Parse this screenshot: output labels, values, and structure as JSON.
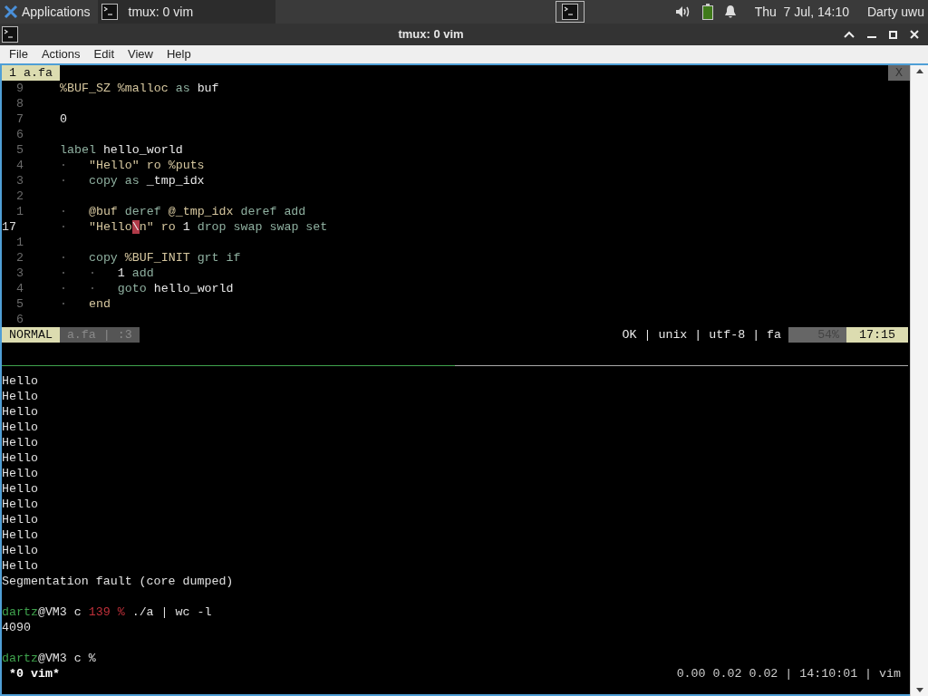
{
  "panel": {
    "menu_label": "Applications",
    "tasks": [
      {
        "label": "tmux: 0 vim",
        "selected": true
      }
    ],
    "clock": "Thu  7 Jul, 14:10",
    "user": "Darty uwu"
  },
  "window": {
    "title": "tmux: 0 vim"
  },
  "menu": [
    "File",
    "Actions",
    "Edit",
    "View",
    "Help"
  ],
  "vim": {
    "tabs": [
      {
        "label": "1 a.fa",
        "selected": true
      }
    ],
    "close_label": "X",
    "lines": [
      {
        "number": "9",
        "current": false,
        "segments": [
          {
            "kind": "literal",
            "text": "%BUF_SZ %malloc "
          },
          {
            "kind": "keyword",
            "text": "as "
          },
          {
            "kind": "plain",
            "text": "buf"
          }
        ]
      },
      {
        "number": "8",
        "current": false
      },
      {
        "number": "7",
        "current": false,
        "segments": [
          {
            "kind": "plain",
            "text": "0"
          }
        ]
      },
      {
        "number": "6",
        "current": false
      },
      {
        "number": "5",
        "current": false,
        "segments": [
          {
            "kind": "keyword",
            "text": "label "
          },
          {
            "kind": "plain",
            "text": "hello_world"
          }
        ]
      },
      {
        "number": "4",
        "current": false,
        "segments": [
          {
            "kind": "guide",
            "text": "·   "
          },
          {
            "kind": "literal",
            "text": "\"Hello\" ro %puts"
          }
        ]
      },
      {
        "number": "3",
        "current": false,
        "segments": [
          {
            "kind": "guide",
            "text": "·   "
          },
          {
            "kind": "keyword",
            "text": "copy as "
          },
          {
            "kind": "plain",
            "text": "_tmp_idx"
          }
        ]
      },
      {
        "number": "2",
        "current": false
      },
      {
        "number": "1",
        "current": false,
        "segments": [
          {
            "kind": "guide",
            "text": "·   "
          },
          {
            "kind": "literal",
            "text": "@buf "
          },
          {
            "kind": "keyword",
            "text": "deref "
          },
          {
            "kind": "literal",
            "text": "@_tmp_idx "
          },
          {
            "kind": "keyword",
            "text": "deref add"
          }
        ]
      },
      {
        "number": "17",
        "current": true,
        "segments": [
          {
            "kind": "guide",
            "text": "·   "
          },
          {
            "kind": "literal",
            "text": "\"Hello"
          },
          {
            "kind": "cursor",
            "text": "\\"
          },
          {
            "kind": "literal",
            "text": "n\" ro "
          },
          {
            "kind": "plain",
            "text": "1 "
          },
          {
            "kind": "keyword",
            "text": "drop swap swap set"
          }
        ]
      },
      {
        "number": "1",
        "current": false
      },
      {
        "number": "2",
        "current": false,
        "segments": [
          {
            "kind": "guide",
            "text": "·   "
          },
          {
            "kind": "keyword",
            "text": "copy "
          },
          {
            "kind": "literal",
            "text": "%BUF_INIT "
          },
          {
            "kind": "keyword",
            "text": "grt if"
          }
        ]
      },
      {
        "number": "3",
        "current": false,
        "segments": [
          {
            "kind": "guide",
            "text": "·   ·   "
          },
          {
            "kind": "plain",
            "text": "1 "
          },
          {
            "kind": "keyword",
            "text": "add"
          }
        ]
      },
      {
        "number": "4",
        "current": false,
        "segments": [
          {
            "kind": "guide",
            "text": "·   ·   "
          },
          {
            "kind": "keyword",
            "text": "goto "
          },
          {
            "kind": "plain",
            "text": "hello_world"
          }
        ]
      },
      {
        "number": "5",
        "current": false,
        "segments": [
          {
            "kind": "guide",
            "text": "·   "
          },
          {
            "kind": "literal",
            "text": "end"
          }
        ]
      },
      {
        "number": "6",
        "current": false
      }
    ],
    "status": {
      "mode": "NORMAL",
      "file": "a.fa | :3",
      "info": "OK | unix | utf-8 | fa",
      "percent": "54%",
      "time": "17:15"
    }
  },
  "shell": {
    "lines": [
      {
        "kind": "text",
        "segments": [
          {
            "kind": "plain",
            "text": "Hello"
          }
        ]
      },
      {
        "kind": "text",
        "segments": [
          {
            "kind": "plain",
            "text": "Hello"
          }
        ]
      },
      {
        "kind": "text",
        "segments": [
          {
            "kind": "plain",
            "text": "Hello"
          }
        ]
      },
      {
        "kind": "text",
        "segments": [
          {
            "kind": "plain",
            "text": "Hello"
          }
        ]
      },
      {
        "kind": "text",
        "segments": [
          {
            "kind": "plain",
            "text": "Hello"
          }
        ]
      },
      {
        "kind": "text",
        "segments": [
          {
            "kind": "plain",
            "text": "Hello"
          }
        ]
      },
      {
        "kind": "text",
        "segments": [
          {
            "kind": "plain",
            "text": "Hello"
          }
        ]
      },
      {
        "kind": "text",
        "segments": [
          {
            "kind": "plain",
            "text": "Hello"
          }
        ]
      },
      {
        "kind": "text",
        "segments": [
          {
            "kind": "plain",
            "text": "Hello"
          }
        ]
      },
      {
        "kind": "text",
        "segments": [
          {
            "kind": "plain",
            "text": "Hello"
          }
        ]
      },
      {
        "kind": "text",
        "segments": [
          {
            "kind": "plain",
            "text": "Hello"
          }
        ]
      },
      {
        "kind": "text",
        "segments": [
          {
            "kind": "plain",
            "text": "Hello"
          }
        ]
      },
      {
        "kind": "text",
        "segments": [
          {
            "kind": "plain",
            "text": "Hello"
          }
        ]
      },
      {
        "kind": "text",
        "segments": [
          {
            "kind": "plain",
            "text": "Segmentation fault (core dumped)"
          }
        ]
      },
      {
        "kind": "blank"
      },
      {
        "kind": "text",
        "segments": [
          {
            "kind": "user",
            "text": "dartz"
          },
          {
            "kind": "plain",
            "text": "@VM3 c "
          },
          {
            "kind": "error",
            "text": "139 % "
          },
          {
            "kind": "plain",
            "text": "./a | wc -l"
          }
        ]
      },
      {
        "kind": "text",
        "segments": [
          {
            "kind": "plain",
            "text": "4090"
          }
        ]
      },
      {
        "kind": "blank"
      },
      {
        "kind": "text",
        "segments": [
          {
            "kind": "user",
            "text": "dartz"
          },
          {
            "kind": "plain",
            "text": "@VM3 c %"
          }
        ]
      }
    ]
  },
  "tmux_status": {
    "windows": [
      {
        "label": "*0 vim*",
        "selected": true
      }
    ],
    "right": "0.00 0.02 0.02 | 14:10:01 | vim"
  }
}
